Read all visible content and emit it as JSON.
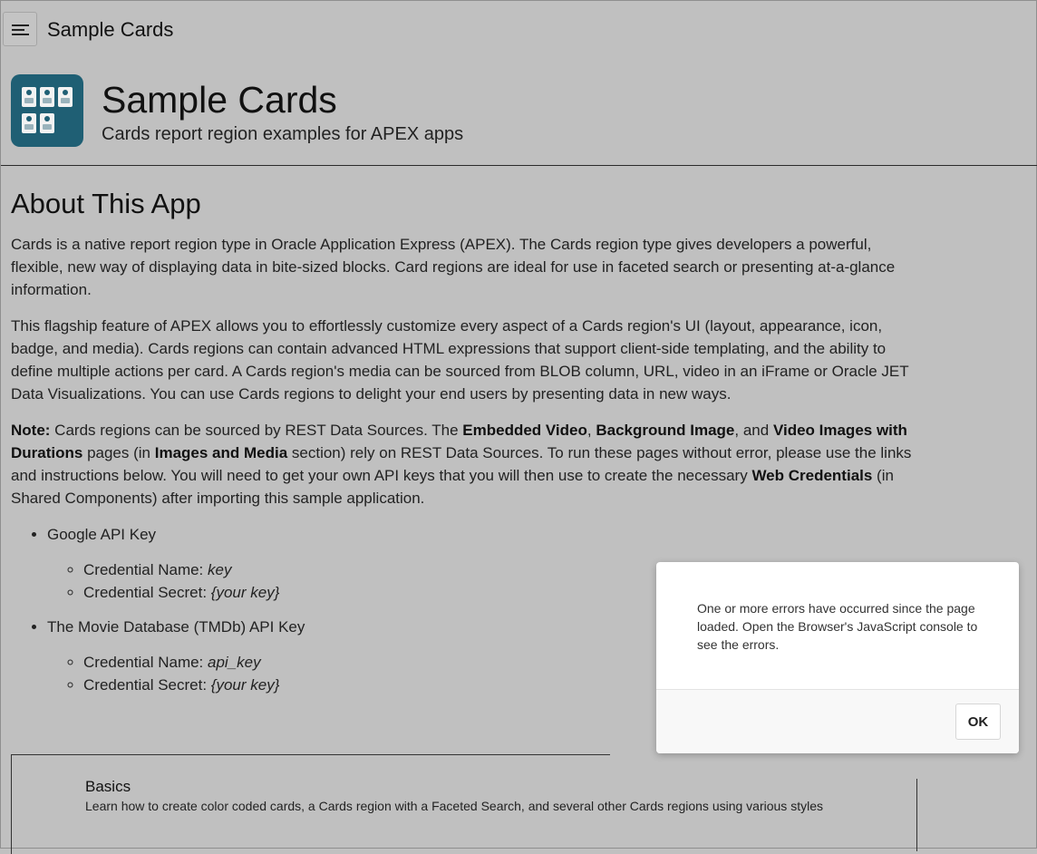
{
  "app": {
    "title": "Sample Cards"
  },
  "hero": {
    "title": "Sample Cards",
    "subtitle": "Cards report region examples for APEX apps"
  },
  "about": {
    "heading": "About This App",
    "p1": "Cards is a native report region type in Oracle Application Express (APEX). The Cards region type gives developers a powerful, flexible, new way of displaying data in bite-sized blocks. Card regions are ideal for use in faceted search or presenting at-a-glance information.",
    "p2": "This flagship feature of APEX allows you to effortlessly customize every aspect of a Cards region's UI (layout, appearance, icon, badge, and media). Cards regions can contain advanced HTML expressions that support client-side templating, and the ability to define multiple actions per card. A Cards region's media can be sourced from BLOB column, URL, video in an iFrame or Oracle JET Data Visualizations. You can use Cards regions to delight your end users by presenting data in new ways.",
    "note": {
      "label": "Note:",
      "t1": " Cards regions can be sourced by REST Data Sources. The ",
      "b1": "Embedded Video",
      "t2": ", ",
      "b2": "Background Image",
      "t3": ", and ",
      "b3": "Video Images with Durations",
      "t4": " pages (in ",
      "b4": "Images and Media",
      "t5": " section) rely on REST Data Sources. To run these pages without error, please use the links and instructions below. You will need to get your own API keys that you will then use to create the necessary ",
      "b5": "Web Credentials",
      "t6": " (in Shared Components) after importing this sample application."
    },
    "keys": [
      {
        "label": "Google API Key",
        "name_label": "Credential Name: ",
        "name_value": "key",
        "secret_label": "Credential Secret: ",
        "secret_value": "{your key}"
      },
      {
        "label": "The Movie Database (TMDb) API Key",
        "name_label": "Credential Name: ",
        "name_value": "api_key",
        "secret_label": "Credential Secret: ",
        "secret_value": "{your key}"
      }
    ]
  },
  "card": {
    "title": "Basics",
    "description": "Learn how to create color coded cards, a Cards region with a Faceted Search, and several other Cards regions using various styles"
  },
  "dialog": {
    "message": "One or more errors have occurred since the page loaded. Open the Browser's JavaScript console to see the errors.",
    "ok_label": "OK"
  }
}
